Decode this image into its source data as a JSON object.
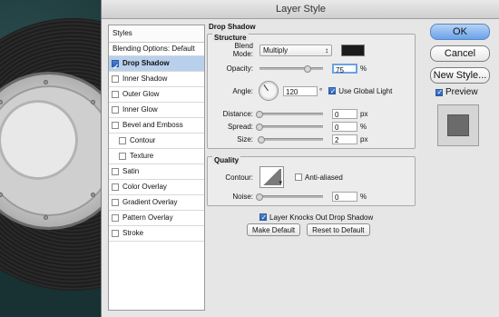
{
  "window": {
    "title": "Layer Style"
  },
  "sidebar": {
    "header": "Styles",
    "blending": "Blending Options: Default",
    "items": [
      {
        "label": "Drop Shadow",
        "checked": true,
        "selected": true,
        "indent": false
      },
      {
        "label": "Inner Shadow",
        "checked": false,
        "selected": false,
        "indent": false
      },
      {
        "label": "Outer Glow",
        "checked": false,
        "selected": false,
        "indent": false
      },
      {
        "label": "Inner Glow",
        "checked": false,
        "selected": false,
        "indent": false
      },
      {
        "label": "Bevel and Emboss",
        "checked": false,
        "selected": false,
        "indent": false
      },
      {
        "label": "Contour",
        "checked": false,
        "selected": false,
        "indent": true
      },
      {
        "label": "Texture",
        "checked": false,
        "selected": false,
        "indent": true
      },
      {
        "label": "Satin",
        "checked": false,
        "selected": false,
        "indent": false
      },
      {
        "label": "Color Overlay",
        "checked": false,
        "selected": false,
        "indent": false
      },
      {
        "label": "Gradient Overlay",
        "checked": false,
        "selected": false,
        "indent": false
      },
      {
        "label": "Pattern Overlay",
        "checked": false,
        "selected": false,
        "indent": false
      },
      {
        "label": "Stroke",
        "checked": false,
        "selected": false,
        "indent": false
      }
    ]
  },
  "panel": {
    "title": "Drop Shadow",
    "structure": {
      "title": "Structure",
      "blend_mode_label": "Blend Mode:",
      "blend_mode_value": "Multiply",
      "shadow_color": "#1b1b1b",
      "opacity_label": "Opacity:",
      "opacity_value": "75",
      "opacity_unit": "%",
      "opacity_fraction": 0.75,
      "angle_label": "Angle:",
      "angle_value": "120",
      "angle_unit": "°",
      "use_global_light_label": "Use Global Light",
      "distance_label": "Distance:",
      "distance_value": "0",
      "distance_unit": "px",
      "distance_fraction": 0.0,
      "spread_label": "Spread:",
      "spread_value": "0",
      "spread_unit": "%",
      "spread_fraction": 0.0,
      "size_label": "Size:",
      "size_value": "2",
      "size_unit": "px",
      "size_fraction": 0.03
    },
    "quality": {
      "title": "Quality",
      "contour_label": "Contour:",
      "anti_aliased_label": "Anti-aliased",
      "noise_label": "Noise:",
      "noise_value": "0",
      "noise_unit": "%",
      "noise_fraction": 0.0
    },
    "knocks_out_label": "Layer Knocks Out Drop Shadow",
    "make_default_label": "Make Default",
    "reset_default_label": "Reset to Default"
  },
  "right_panel": {
    "ok_label": "OK",
    "cancel_label": "Cancel",
    "new_style_label": "New Style...",
    "preview_label": "Preview"
  },
  "colors": {
    "selection": "#b8d0ec",
    "primary_button": "#6aa3ea"
  }
}
